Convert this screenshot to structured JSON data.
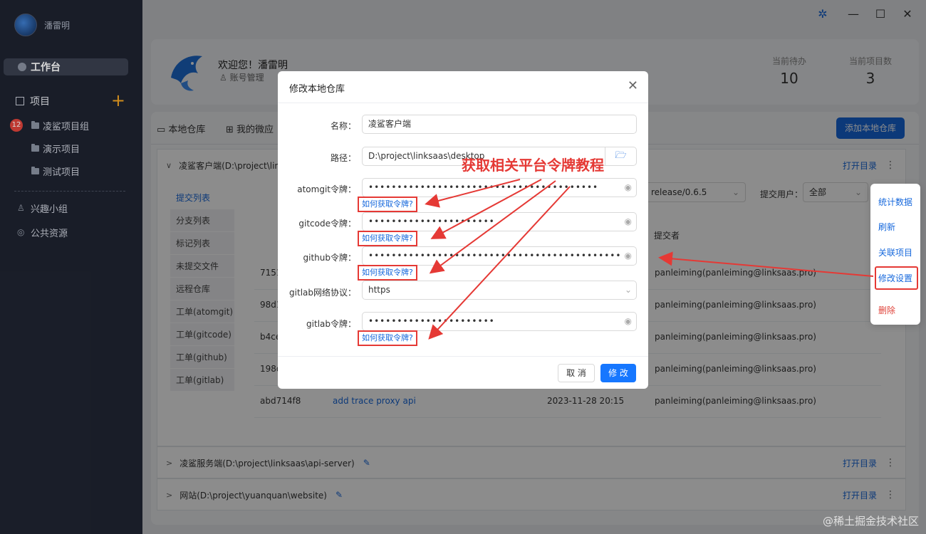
{
  "sidebar": {
    "username": "潘雷明",
    "workbench": "工作台",
    "projects_label": "项目",
    "badge": "12",
    "project_items": [
      {
        "label": "凌鲨项目组"
      },
      {
        "label": "演示项目"
      },
      {
        "label": "测试项目"
      }
    ],
    "interest_group": "兴趣小组",
    "public_resources": "公共资源"
  },
  "header": {
    "welcome": "欢迎您！潘雷明",
    "account": "账号管理",
    "stats": [
      {
        "label": "当前待办",
        "value": "10"
      },
      {
        "label": "当前项目数",
        "value": "3"
      }
    ]
  },
  "tabs": {
    "local_repo": "本地仓库",
    "my_micro": "我的微应",
    "add_button": "添加本地仓库"
  },
  "repos": [
    {
      "name": "凌鲨客户端(D:\\project\\links",
      "open": "打开目录"
    },
    {
      "name": "凌鲨服务端(D:\\project\\linksaas\\api-server)",
      "open": "打开目录"
    },
    {
      "name": "网站(D:\\project\\yuanquan\\website)",
      "open": "打开目录"
    }
  ],
  "subtabs": [
    "提交列表",
    "分支列表",
    "标记列表",
    "未提交文件",
    "远程仓库",
    "工单(atomgit)",
    "工单(gitcode)",
    "工单(github)",
    "工单(gitlab)"
  ],
  "filters": {
    "branch": "release/0.6.5",
    "user_label": "提交用户：",
    "user_value": "全部"
  },
  "commits": {
    "header_user": "提交者",
    "rows": [
      {
        "hash": "7151",
        "msg": "",
        "date": "",
        "user": "panleiming(panleiming@linksaas.pro)"
      },
      {
        "hash": "98d1",
        "msg": "",
        "date": "",
        "user": "panleiming(panleiming@linksaas.pro)"
      },
      {
        "hash": "b4ce",
        "msg": "",
        "date": "",
        "user": "panleiming(panleiming@linksaas.pro)"
      },
      {
        "hash": "198d",
        "msg": "",
        "date": "",
        "user": "panleiming(panleiming@linksaas.pro)"
      },
      {
        "hash": "abd714f8",
        "msg": "add trace proxy api",
        "date": "2023-11-28 20:15",
        "user": "panleiming(panleiming@linksaas.pro)"
      }
    ]
  },
  "context_menu": {
    "items": [
      {
        "label": "统计数据"
      },
      {
        "label": "刷新"
      },
      {
        "label": "关联项目"
      },
      {
        "label": "修改设置"
      },
      {
        "label": "删除"
      }
    ]
  },
  "dialog": {
    "title": "修改本地仓库",
    "fields": {
      "name_label": "名称：",
      "name_value": "凌鲨客户端",
      "path_label": "路径：",
      "path_value": "D:\\project\\linksaas\\desktop",
      "atomgit_label": "atomgit令牌：",
      "atomgit_value": "••••••••••••••••••••••••••••••••••••••••",
      "gitcode_label": "gitcode令牌：",
      "gitcode_value": "••••••••••••••••••••••",
      "github_label": "github令牌：",
      "github_value": "••••••••••••••••••••••••••••••••••••••••••••",
      "gitlab_proto_label": "gitlab网络协议：",
      "gitlab_proto_value": "https",
      "gitlab_label": "gitlab令牌：",
      "gitlab_value": "••••••••••••••••••••••"
    },
    "howto": "如何获取令牌?",
    "cancel": "取 消",
    "ok": "修 改"
  },
  "annotation": "获取相关平台令牌教程",
  "watermark": "@稀土掘金技术社区",
  "colors": {
    "accent": "#1668dc",
    "highlight": "#e53935",
    "sidebar": "#1e2330"
  },
  "icons": [
    "gear-icon",
    "bug-icon",
    "minimize-icon",
    "maximize-icon",
    "close-icon",
    "folder-icon",
    "eye-icon",
    "plus-icon",
    "edit-icon",
    "chevron-down-icon",
    "chevron-right-icon",
    "more-icon"
  ]
}
